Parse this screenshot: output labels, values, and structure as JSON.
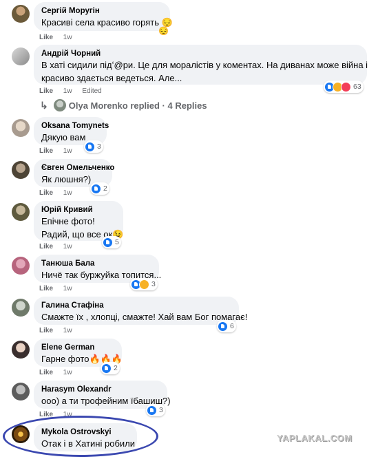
{
  "comments": [
    {
      "author": "Сергій Моругін",
      "lines": [
        "Красиві села красиво горять 😔"
      ],
      "extra_emoji": "😔",
      "like": "Like",
      "time": "1w",
      "edited": "",
      "reaction_count": ""
    },
    {
      "author": "Андрій Чорний",
      "lines": [
        "В хаті сидили підʻ@ри. Це для моралістів у коментах. На диванах може війна і",
        "красиво здається ведеться. Але..."
      ],
      "like": "Like",
      "time": "1w",
      "edited": "Edited",
      "reaction_count": "63"
    },
    {
      "author": "Oksana Tomynets",
      "lines": [
        "Дякую вам"
      ],
      "like": "Like",
      "time": "1w",
      "reaction_count": "3"
    },
    {
      "author": "Євген Омельченко",
      "lines": [
        "Як люшня?)"
      ],
      "like": "Like",
      "time": "1w",
      "reaction_count": "2"
    },
    {
      "author": "Юрій Кривий",
      "lines": [
        "Епічне фото!",
        "Радий, що все ок😉"
      ],
      "like": "Like",
      "time": "1w",
      "reaction_count": "5"
    },
    {
      "author": "Танюша Бала",
      "lines": [
        "Ничё так буржуйка топится..."
      ],
      "like": "Like",
      "time": "1w",
      "reaction_count": "3"
    },
    {
      "author": "Галина Стафіна",
      "lines": [
        "Смажте їх , хлопці, смажте! Хай вам Бог помагає!"
      ],
      "like": "Like",
      "time": "1w",
      "reaction_count": "6"
    },
    {
      "author": "Elene German",
      "lines": [
        "Гарне фото🔥🔥🔥"
      ],
      "like": "Like",
      "time": "1w",
      "reaction_count": "2"
    },
    {
      "author": "Harasym Olexandr",
      "lines": [
        "ооо) а ти трофейним їбашиш?)"
      ],
      "like": "Like",
      "time": "1w",
      "reaction_count": "3"
    },
    {
      "author": "Mykola Ostrovskyi",
      "lines": [
        "Отак і в Хатині робили"
      ]
    }
  ],
  "replies": {
    "arrow": "↳",
    "text": "Olya Morenko replied · 4 Replies"
  },
  "watermark": "YAPLAKAL.COM",
  "colors": {
    "bubble": "#f0f2f5",
    "meta": "#65676b",
    "like_reaction": "#1877f2",
    "highlight_circle": "#3b48b0"
  }
}
